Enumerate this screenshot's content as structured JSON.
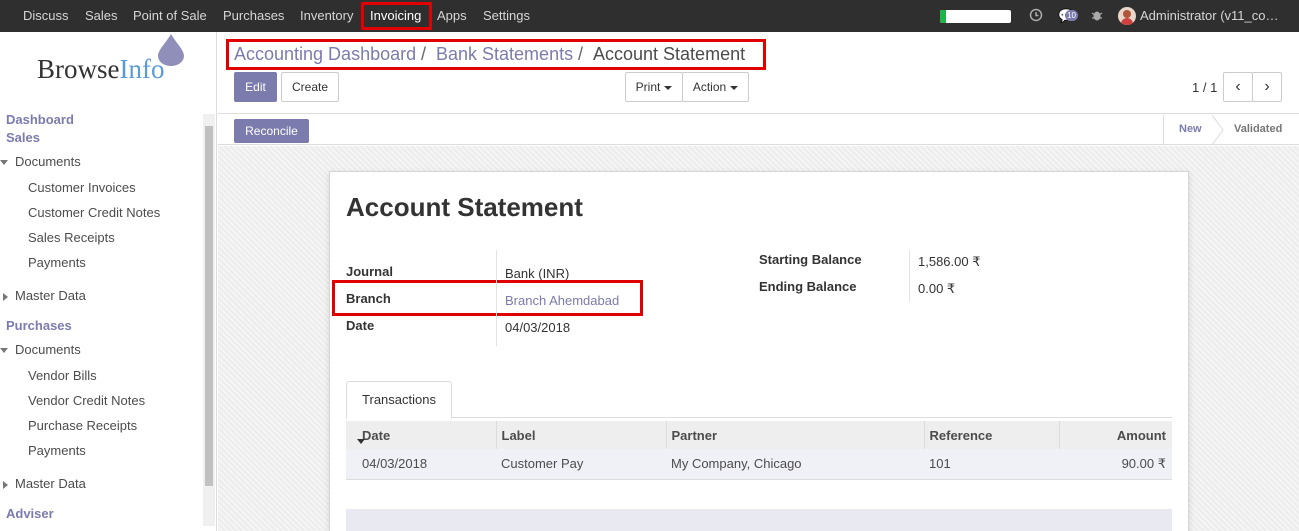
{
  "topbar": {
    "menu": [
      "Discuss",
      "Sales",
      "Point of Sale",
      "Purchases",
      "Inventory",
      "Invoicing",
      "Apps",
      "Settings"
    ],
    "active": "Invoicing",
    "chat_count": "10",
    "user": "Administrator (v11_co…"
  },
  "sidebar": {
    "logo_a": "Browse",
    "logo_b": "Info",
    "dashboard": "Dashboard",
    "sales": "Sales",
    "sales_documents": "Documents",
    "sales_items": [
      "Customer Invoices",
      "Customer Credit Notes",
      "Sales Receipts",
      "Payments"
    ],
    "sales_master": "Master Data",
    "purchases": "Purchases",
    "purchases_documents": "Documents",
    "purchases_items": [
      "Vendor Bills",
      "Vendor Credit Notes",
      "Purchase Receipts",
      "Payments"
    ],
    "purchases_master": "Master Data",
    "adviser": "Adviser"
  },
  "breadcrumb": {
    "items": [
      "Accounting Dashboard",
      "Bank Statements",
      "Account Statement"
    ],
    "sep": "/"
  },
  "buttons": {
    "edit": "Edit",
    "create": "Create",
    "print": "Print",
    "action": "Action",
    "pager": "1 / 1",
    "reconcile": "Reconcile"
  },
  "states": [
    "New",
    "Validated"
  ],
  "form": {
    "title": "Account Statement",
    "journal_label": "Journal",
    "journal_value": "Bank (INR)",
    "branch_label": "Branch",
    "branch_value": "Branch Ahemdabad",
    "date_label": "Date",
    "date_value": "04/03/2018",
    "start_label": "Starting Balance",
    "start_value": "1,586.00 ₹",
    "end_label": "Ending Balance",
    "end_value": "0.00 ₹"
  },
  "tab": "Transactions",
  "table": {
    "headers": [
      "Date",
      "Label",
      "Partner",
      "Reference",
      "Amount"
    ],
    "rows": [
      [
        "04/03/2018",
        "Customer Pay",
        "My Company, Chicago",
        "101",
        "90.00 ₹"
      ]
    ]
  }
}
